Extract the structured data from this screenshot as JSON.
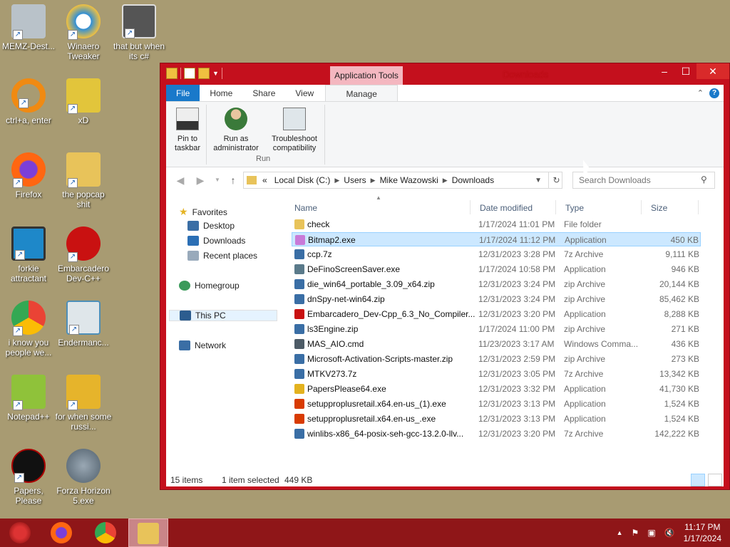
{
  "desktop_icons": [
    {
      "label": "MEMZ-Dest...",
      "icon": "recycle-bin-icon",
      "color": "#b9c2c9"
    },
    {
      "label": "Winaero Tweaker",
      "icon": "winaero-icon",
      "color": "#2f8fd8"
    },
    {
      "label": "that but when its c#",
      "icon": "windows-stack-icon",
      "color": "#555555"
    },
    {
      "label": "ctrl+a, enter",
      "icon": "search-ring-icon",
      "color": "#f08a12"
    },
    {
      "label": "xD",
      "icon": "hxd-icon",
      "color": "#e2c53b"
    },
    {
      "label": "Firefox",
      "icon": "firefox-icon",
      "color": "#ff6611"
    },
    {
      "label": "the popcap shit",
      "icon": "folder-icon",
      "color": "#e8c35a"
    },
    {
      "label": "forkie attractant",
      "icon": "monitor-gear-icon",
      "color": "#1e88c9"
    },
    {
      "label": "Embarcadero Dev-C++",
      "icon": "devcpp-icon",
      "color": "#c91111"
    },
    {
      "label": "i know you people we...",
      "icon": "chrome-icon",
      "color": "#34a853"
    },
    {
      "label": "Endermanc...",
      "icon": "window-app-icon",
      "color": "#4e8fb8"
    },
    {
      "label": "Notepad++",
      "icon": "notepadpp-icon",
      "color": "#8fc23a"
    },
    {
      "label": "for when some russi...",
      "icon": "die-icon",
      "color": "#e6b42b"
    },
    {
      "label": "Papers, Please",
      "icon": "papers-please-icon",
      "color": "#111111"
    },
    {
      "label": "Forza Horizon 5.exe",
      "icon": "flash-icon",
      "color": "#6a7a88"
    }
  ],
  "window": {
    "title": "Downloads",
    "context_tab": "Application Tools",
    "tabs": [
      "File",
      "Home",
      "Share",
      "View",
      "Manage"
    ],
    "active_tab": "Manage",
    "ribbon": {
      "pin_label": "Pin to taskbar",
      "run_admin_label": "Run as administrator",
      "troubleshoot_label": "Troubleshoot compatibility",
      "group_label": "Run"
    },
    "address": {
      "prefix": "«",
      "crumbs": [
        "Local Disk (C:)",
        "Users",
        "Mike Wazowski",
        "Downloads"
      ],
      "search_placeholder": "Search Downloads"
    },
    "nav": {
      "favorites": "Favorites",
      "desktop": "Desktop",
      "downloads": "Downloads",
      "recent": "Recent places",
      "homegroup": "Homegroup",
      "this_pc": "This PC",
      "network": "Network"
    },
    "columns": {
      "name": "Name",
      "date": "Date modified",
      "type": "Type",
      "size": "Size"
    },
    "files": [
      {
        "name": "check",
        "date": "1/17/2024 11:01 PM",
        "type": "File folder",
        "size": "",
        "icon": "folder-icon",
        "color": "#e8c35a"
      },
      {
        "name": "Bitmap2.exe",
        "date": "1/17/2024 11:12 PM",
        "type": "Application",
        "size": "450 KB",
        "icon": "paint-icon",
        "color": "#c87ad8",
        "selected": true
      },
      {
        "name": "ccp.7z",
        "date": "12/31/2023 3:28 PM",
        "type": "7z Archive",
        "size": "9,111 KB",
        "icon": "archive-icon",
        "color": "#3a6ea5"
      },
      {
        "name": "DeFinoScreenSaver.exe",
        "date": "1/17/2024 10:58 PM",
        "type": "Application",
        "size": "946 KB",
        "icon": "app-icon",
        "color": "#5a7a8a"
      },
      {
        "name": "die_win64_portable_3.09_x64.zip",
        "date": "12/31/2023 3:24 PM",
        "type": "zip Archive",
        "size": "20,144 KB",
        "icon": "archive-icon",
        "color": "#3a6ea5"
      },
      {
        "name": "dnSpy-net-win64.zip",
        "date": "12/31/2023 3:24 PM",
        "type": "zip Archive",
        "size": "85,462 KB",
        "icon": "archive-icon",
        "color": "#3a6ea5"
      },
      {
        "name": "Embarcadero_Dev-Cpp_6.3_No_Compiler...",
        "date": "12/31/2023 3:20 PM",
        "type": "Application",
        "size": "8,288 KB",
        "icon": "devcpp-icon",
        "color": "#c91111"
      },
      {
        "name": "ls3Engine.zip",
        "date": "1/17/2024 11:00 PM",
        "type": "zip Archive",
        "size": "271 KB",
        "icon": "archive-icon",
        "color": "#3a6ea5"
      },
      {
        "name": "MAS_AIO.cmd",
        "date": "11/23/2023 3:17 AM",
        "type": "Windows Comma...",
        "size": "436 KB",
        "icon": "cmd-icon",
        "color": "#4d5b66"
      },
      {
        "name": "Microsoft-Activation-Scripts-master.zip",
        "date": "12/31/2023 2:59 PM",
        "type": "zip Archive",
        "size": "273 KB",
        "icon": "archive-icon",
        "color": "#3a6ea5"
      },
      {
        "name": "MTKV273.7z",
        "date": "12/31/2023 3:05 PM",
        "type": "7z Archive",
        "size": "13,342 KB",
        "icon": "archive-icon",
        "color": "#3a6ea5"
      },
      {
        "name": "PapersPlease64.exe",
        "date": "12/31/2023 3:32 PM",
        "type": "Application",
        "size": "41,730 KB",
        "icon": "papers-icon",
        "color": "#e3b21f"
      },
      {
        "name": "setupproplusretail.x64.en-us_(1).exe",
        "date": "12/31/2023 3:13 PM",
        "type": "Application",
        "size": "1,524 KB",
        "icon": "office-icon",
        "color": "#d83b01"
      },
      {
        "name": "setupproplusretail.x64.en-us_.exe",
        "date": "12/31/2023 3:13 PM",
        "type": "Application",
        "size": "1,524 KB",
        "icon": "office-icon",
        "color": "#d83b01"
      },
      {
        "name": "winlibs-x86_64-posix-seh-gcc-13.2.0-llv...",
        "date": "12/31/2023 3:20 PM",
        "type": "7z Archive",
        "size": "142,222 KB",
        "icon": "archive-icon",
        "color": "#3a6ea5"
      }
    ],
    "status": {
      "count": "15 items",
      "selected": "1 item selected",
      "size": "449 KB"
    }
  },
  "taskbar": {
    "clock_time": "11:17 PM",
    "clock_date": "1/17/2024"
  },
  "colors": {
    "window_frame": "#c4101d",
    "taskbar": "#8f1618",
    "desktop": "#a89b72",
    "accent": "#1979ca"
  }
}
